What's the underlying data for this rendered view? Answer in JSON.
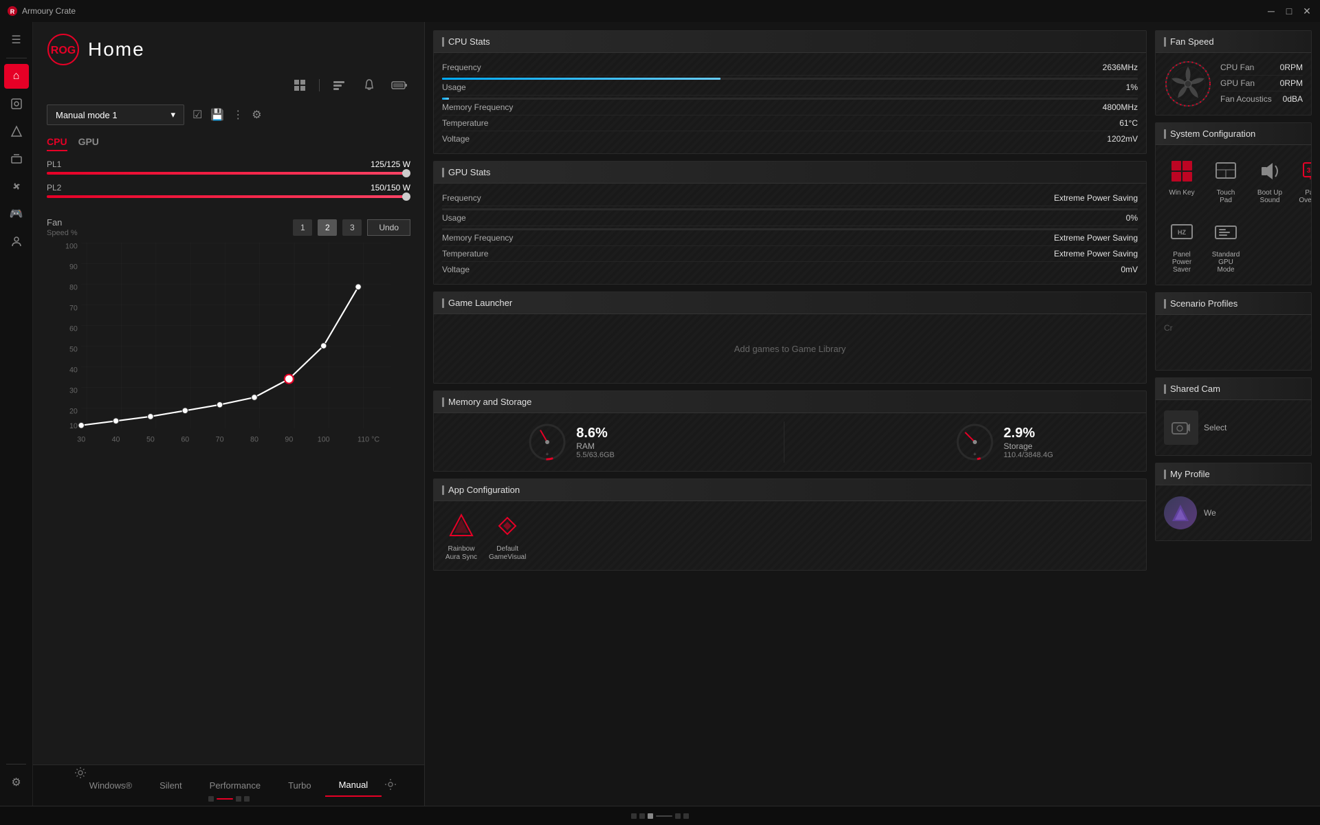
{
  "window": {
    "title": "Armoury Crate",
    "min_btn": "─",
    "max_btn": "□",
    "close_btn": "✕"
  },
  "header": {
    "title": "Home",
    "top_icons": [
      "⊞",
      "|",
      "🔔",
      "🔋"
    ]
  },
  "controls": {
    "mode_label": "Manual mode 1",
    "mode_options": [
      "Manual mode 1",
      "Silent",
      "Performance",
      "Turbo",
      "Windows®"
    ],
    "checkbox_icon": "☑",
    "save_icon": "💾",
    "more_icon": "⋮",
    "settings_icon": "⚙"
  },
  "tabs": {
    "cpu_label": "CPU",
    "gpu_label": "GPU"
  },
  "pl": {
    "pl1_label": "PL1",
    "pl1_value": "125/125 W",
    "pl1_pct": 100,
    "pl2_label": "PL2",
    "pl2_value": "150/150 W",
    "pl2_pct": 100
  },
  "fan": {
    "label": "Fan",
    "sublabel": "Speed %",
    "points": [
      "1",
      "2",
      "3"
    ],
    "undo_label": "Undo",
    "y_labels": [
      "100",
      "90",
      "80",
      "70",
      "60",
      "50",
      "40",
      "30",
      "20",
      "10"
    ],
    "x_labels": [
      "30",
      "40",
      "50",
      "60",
      "70",
      "80",
      "90",
      "100",
      "110 °C"
    ]
  },
  "cpu_stats": {
    "title": "CPU Stats",
    "frequency_label": "Frequency",
    "frequency_value": "2636MHz",
    "usage_label": "Usage",
    "usage_value": "1%",
    "usage_pct": 1,
    "mem_freq_label": "Memory Frequency",
    "mem_freq_value": "4800MHz",
    "temp_label": "Temperature",
    "temp_value": "61°C",
    "voltage_label": "Voltage",
    "voltage_value": "1202mV"
  },
  "gpu_stats": {
    "title": "GPU Stats",
    "frequency_label": "Frequency",
    "frequency_value": "Extreme Power Saving",
    "usage_label": "Usage",
    "usage_value": "0%",
    "usage_pct": 0,
    "mem_freq_label": "Memory Frequency",
    "mem_freq_value": "Extreme Power Saving",
    "temp_label": "Temperature",
    "temp_value": "Extreme Power Saving",
    "voltage_label": "Voltage",
    "voltage_value": "0mV"
  },
  "fan_speed": {
    "title": "Fan Speed",
    "cpu_fan_label": "CPU Fan",
    "cpu_fan_value": "0RPM",
    "gpu_fan_label": "GPU Fan",
    "gpu_fan_value": "0RPM",
    "acoustics_label": "Fan Acoustics",
    "acoustics_value": "0dBA"
  },
  "system_config": {
    "title": "System Configuration",
    "items": [
      {
        "label": "Win Key",
        "icon": "⊞"
      },
      {
        "label": "Touch Pad",
        "icon": "⬛"
      },
      {
        "label": "Boot Up Sound",
        "icon": "🔊"
      },
      {
        "label": "Panel Overdrive",
        "icon": "📺"
      },
      {
        "label": "Panel Power Saver",
        "icon": "HZ"
      },
      {
        "label": "Standard GPU Mode",
        "icon": "🖥"
      }
    ]
  },
  "game_launcher": {
    "title": "Game Launcher",
    "empty_label": "Add games to Game Library"
  },
  "memory_storage": {
    "title": "Memory and Storage",
    "ram_pct": "8.6%",
    "ram_label": "RAM",
    "ram_detail": "5.5/63.6GB",
    "storage_pct": "2.9%",
    "storage_label": "Storage",
    "storage_detail": "110.4/3848.4G"
  },
  "app_config": {
    "title": "App Configuration",
    "items": [
      {
        "label": "Rainbow\nAura Sync",
        "icon": "🔺"
      },
      {
        "label": "Default\nGameVisual",
        "icon": "🎮"
      }
    ]
  },
  "scenario_profiles": {
    "title": "Scenario Profiles"
  },
  "shared_cam": {
    "title": "Shared Cam",
    "select_label": "Select"
  },
  "my_profile": {
    "title": "My Profile",
    "profile_text": "We"
  },
  "sidebar": {
    "items": [
      {
        "icon": "☰",
        "active": false
      },
      {
        "icon": "⌂",
        "active": true
      },
      {
        "icon": "◈",
        "active": false
      },
      {
        "icon": "✦",
        "active": false
      },
      {
        "icon": "⊟",
        "active": false
      },
      {
        "icon": "⚙",
        "active": false
      },
      {
        "icon": "🎮",
        "active": false
      },
      {
        "icon": "⊞",
        "active": false
      }
    ]
  },
  "mode_tabs": {
    "items": [
      "Windows®",
      "Silent",
      "Performance",
      "Turbo",
      "Manual"
    ],
    "active": 4
  },
  "status_bar": {
    "dots": [
      false,
      false,
      true,
      false
    ]
  }
}
